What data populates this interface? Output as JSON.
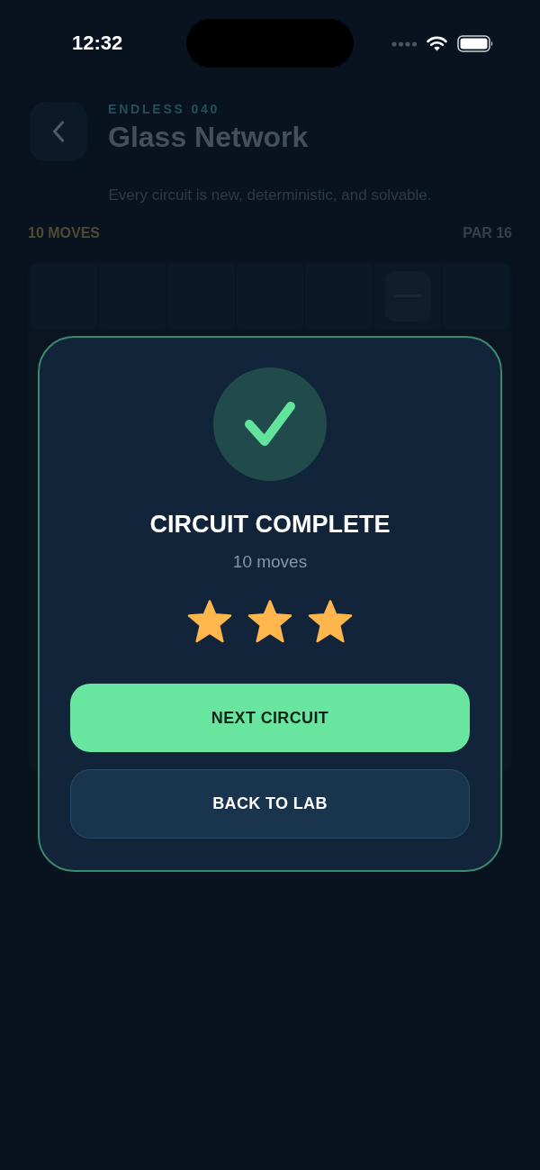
{
  "status_bar": {
    "time": "12:32"
  },
  "header": {
    "eyebrow": "ENDLESS 040",
    "title": "Glass Network",
    "subtitle": "Every circuit is new, deterministic, and solvable."
  },
  "stats": {
    "moves": "10 MOVES",
    "par": "PAR 16"
  },
  "dialog": {
    "title": "CIRCUIT COMPLETE",
    "moves": "10 moves",
    "stars": 3,
    "buttons": [
      {
        "label": "NEXT CIRCUIT",
        "kind": "primary"
      },
      {
        "label": "BACK TO LAB",
        "kind": "secondary"
      }
    ]
  }
}
